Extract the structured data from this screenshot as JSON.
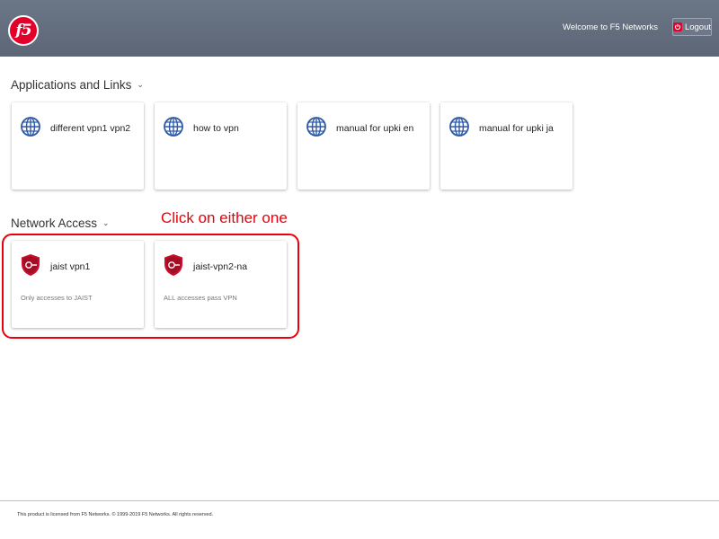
{
  "header": {
    "logo_text": "f5",
    "welcome_text": "Welcome to F5 Networks",
    "logout_label": "Logout",
    "bg_color": "#5f6a7a",
    "accent_color": "#e4002b"
  },
  "applications": {
    "title": "Applications and Links",
    "items": [
      {
        "name": "different vpn1 vpn2",
        "icon": "globe-icon"
      },
      {
        "name": "how to vpn",
        "icon": "globe-icon"
      },
      {
        "name": "manual for upki en",
        "icon": "globe-icon"
      },
      {
        "name": "manual for upki ja",
        "icon": "globe-icon"
      }
    ]
  },
  "network_access": {
    "title": "Network Access",
    "items": [
      {
        "name": "jaist vpn1",
        "description": "Only accesses to JAIST",
        "icon": "shield-icon"
      },
      {
        "name": "jaist-vpn2-na",
        "description": "ALL accesses pass VPN",
        "icon": "shield-icon"
      }
    ]
  },
  "annotation": {
    "text": "Click on either one",
    "color": "#e8000b"
  },
  "footer": {
    "text": "This product is licensed from F5 Networks. © 1999-2019 F5 Networks. All rights reserved."
  }
}
